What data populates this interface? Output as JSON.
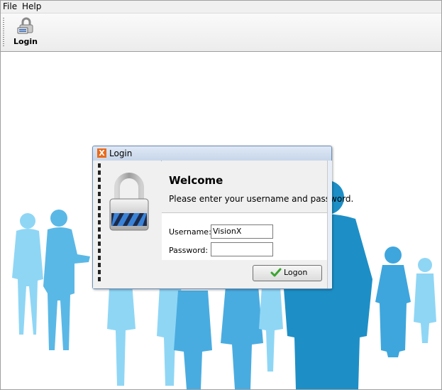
{
  "menubar": {
    "items": [
      {
        "label": "File"
      },
      {
        "label": "Help"
      }
    ]
  },
  "toolbar": {
    "login_label": "Login",
    "login_icon": "padlock-keyboard-icon"
  },
  "dialog": {
    "title": "Login",
    "app_icon": "X",
    "welcome": "Welcome",
    "instruction": "Please enter your username and password.",
    "username_label": "Username:",
    "username_value": "VisionX",
    "password_label": "Password:",
    "password_value": "",
    "logon_label": "Logon",
    "icons": [
      "app-x-icon",
      "padlock-icon",
      "checkmark-icon"
    ]
  },
  "colors": {
    "silhouette_light": "#8fd6f5",
    "silhouette_mid": "#5ab8e6",
    "silhouette_dark": "#1d8fc6",
    "app_icon": "#e96a1c"
  }
}
